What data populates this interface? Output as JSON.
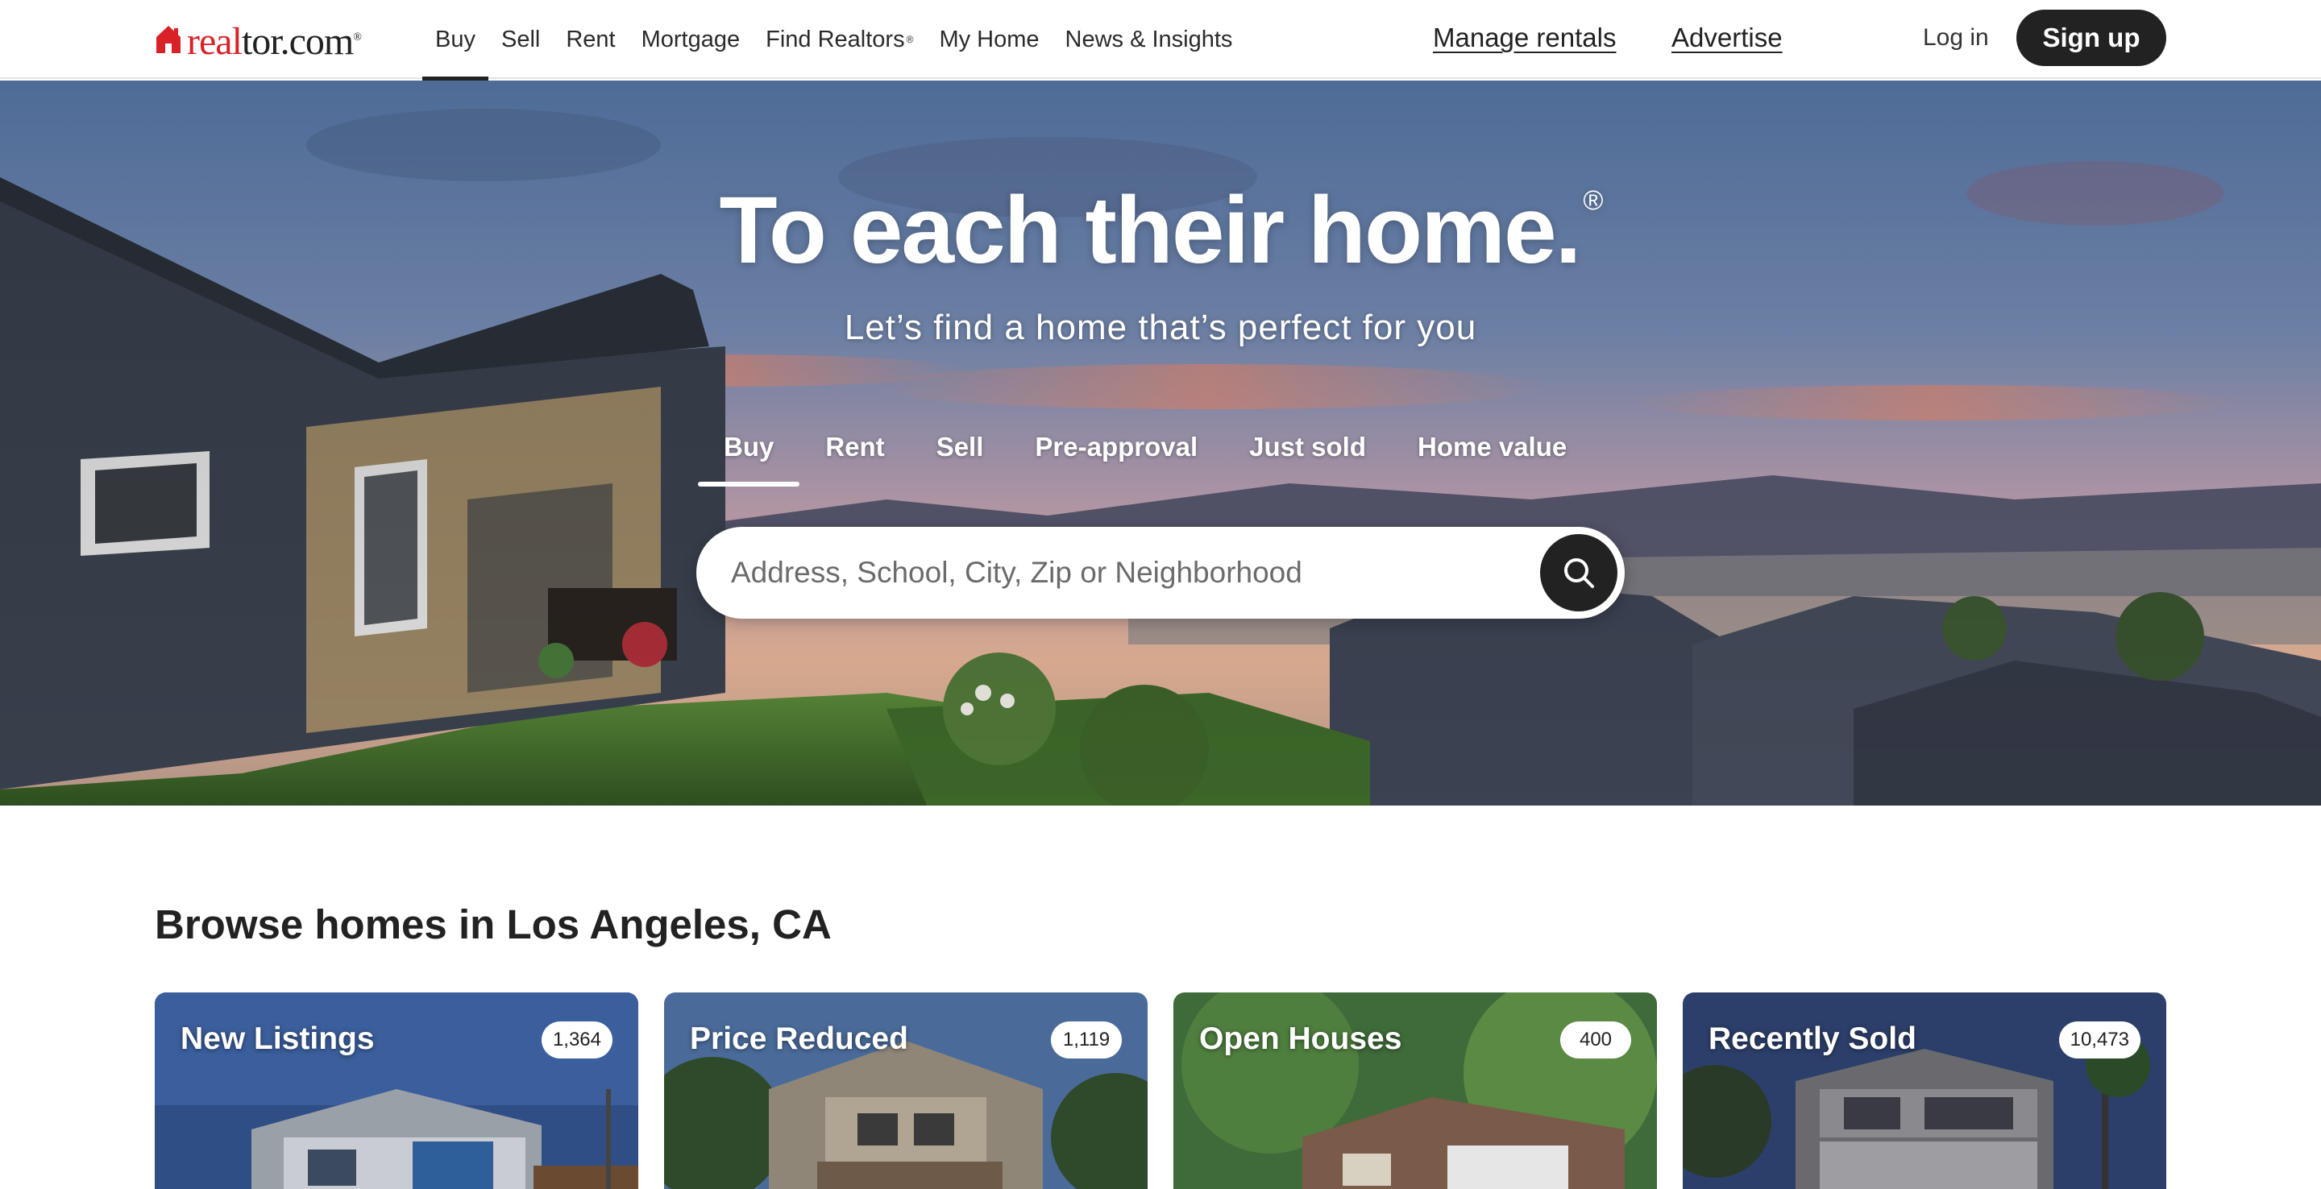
{
  "logo": {
    "text_red": "real",
    "text_black": "tor.com",
    "tm": "®"
  },
  "nav": {
    "items": [
      "Buy",
      "Sell",
      "Rent",
      "Mortgage",
      "Find Realtors",
      "My Home",
      "News & Insights"
    ],
    "find_realtors_sup": "®",
    "active": "Buy",
    "manage_rentals": "Manage rentals",
    "advertise": "Advertise",
    "login": "Log in",
    "signup": "Sign up"
  },
  "hero": {
    "title": "To each their home.",
    "title_reg": "®",
    "subtitle": "Let’s find a home that’s perfect for you",
    "tabs": [
      "Buy",
      "Rent",
      "Sell",
      "Pre-approval",
      "Just sold",
      "Home value"
    ],
    "active_tab": "Buy",
    "search_placeholder": "Address, School, City, Zip or Neighborhood",
    "search_value": ""
  },
  "browse": {
    "title": "Browse homes in Los Angeles, CA",
    "cards": [
      {
        "label": "New Listings",
        "count": "1,364"
      },
      {
        "label": "Price Reduced",
        "count": "1,119"
      },
      {
        "label": "Open Houses",
        "count": "400"
      },
      {
        "label": "Recently Sold",
        "count": "10,473"
      }
    ]
  },
  "colors": {
    "brand_red": "#d92228",
    "dark": "#222222",
    "white": "#ffffff"
  },
  "icons": {
    "search": "search-icon",
    "logo": "house-logo-icon"
  }
}
